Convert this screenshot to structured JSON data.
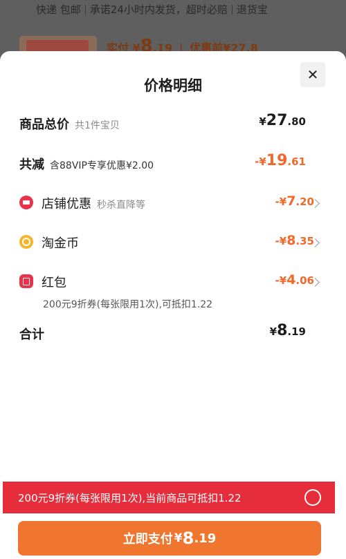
{
  "background": {
    "info_items": [
      "快递 包邮",
      "承诺24小时内发货，超时必赔",
      "退货宝"
    ],
    "paid_label": "实付",
    "paid_currency": "¥",
    "paid_int": "8",
    "paid_dec": ".19",
    "pre_discount": "优惠前¥27.8"
  },
  "sheet": {
    "title": "价格明细",
    "close_glyph": "✕",
    "rows": {
      "total": {
        "label": "商品总价",
        "sub": "共1件宝贝",
        "cur": "¥",
        "int": "27",
        "dec": ".80"
      },
      "reduce": {
        "label": "共减",
        "sub": "含88VIP专享优惠¥2.00",
        "cur": "-¥",
        "int": "19",
        "dec": ".61"
      },
      "shop": {
        "label": "店铺优惠",
        "sub": "秒杀直降等",
        "cur": "-¥",
        "int": "7",
        "dec": ".20"
      },
      "coin": {
        "label": "淘金币",
        "cur": "-¥",
        "int": "8",
        "dec": ".35"
      },
      "redpack": {
        "label": "红包",
        "cur": "-¥",
        "int": "4",
        "dec": ".06",
        "detail": "200元9折券(每张限用1次),可抵扣1.22"
      },
      "sum": {
        "label": "合计",
        "cur": "¥",
        "int": "8",
        "dec": ".19"
      }
    }
  },
  "coupon_bar": {
    "text": "200元9折券(每张限用1次),当前商品可抵扣1.22"
  },
  "pay_button": {
    "label": "立即支付",
    "cur": "¥",
    "int": "8",
    "dec": ".19"
  },
  "colors": {
    "accent": "#f2672a",
    "red_bar": "#e52d3c",
    "pay": "#f0752e"
  }
}
